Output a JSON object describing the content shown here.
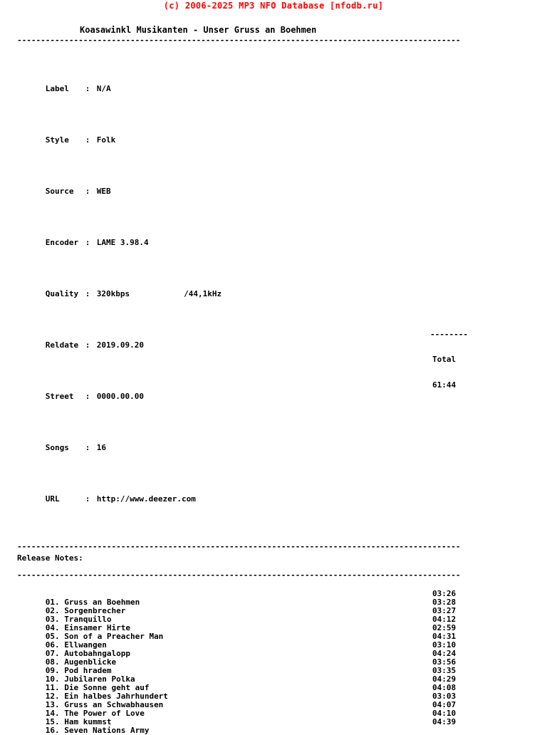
{
  "header": {
    "banner": "(c) 2006-2025 MP3 NFO Database [nfodb.ru]",
    "banner_color": "#ff0000"
  },
  "release": {
    "title": "Koasawinkl Musikanten - Unser Gruss an Boehmen"
  },
  "separators": {
    "long": "----------------------------------------------------------------------------------------------",
    "short": "--------"
  },
  "meta": {
    "rows": [
      {
        "key": "Label",
        "sep": ":",
        "value": "N/A",
        "extra": ""
      },
      {
        "key": "Style",
        "sep": ":",
        "value": "Folk",
        "extra": ""
      },
      {
        "key": "Source",
        "sep": ":",
        "value": "WEB",
        "extra": ""
      },
      {
        "key": "Encoder",
        "sep": ":",
        "value": "LAME 3.98.4",
        "extra": ""
      },
      {
        "key": "Quality",
        "sep": ":",
        "value": "320kbps",
        "extra": "/44,1kHz"
      },
      {
        "key": "Reldate",
        "sep": ":",
        "value": "2019.09.20",
        "extra": ""
      },
      {
        "key": "Street",
        "sep": ":",
        "value": "0000.00.00",
        "extra": ""
      },
      {
        "key": "Songs",
        "sep": ":",
        "value": "16",
        "extra": ""
      },
      {
        "key": "URL",
        "sep": ":",
        "value": "http://www.deezer.com",
        "extra": ""
      }
    ]
  },
  "notes": {
    "label": "Release Notes:",
    "body": ""
  },
  "tracks": [
    {
      "num": "01.",
      "title": "Gruss an Boehmen",
      "time": "03:26"
    },
    {
      "num": "02.",
      "title": "Sorgenbrecher",
      "time": "03:28"
    },
    {
      "num": "03.",
      "title": "Tranquillo",
      "time": "03:27"
    },
    {
      "num": "04.",
      "title": "Einsamer Hirte",
      "time": "04:12"
    },
    {
      "num": "05.",
      "title": "Son of a Preacher Man",
      "time": "02:59"
    },
    {
      "num": "06.",
      "title": "Ellwangen",
      "time": "04:31"
    },
    {
      "num": "07.",
      "title": "Autobahngalopp",
      "time": "03:10"
    },
    {
      "num": "08.",
      "title": "Augenblicke",
      "time": "04:24"
    },
    {
      "num": "09.",
      "title": "Pod hradem",
      "time": "03:56"
    },
    {
      "num": "10.",
      "title": "Jubilaren Polka",
      "time": "03:35"
    },
    {
      "num": "11.",
      "title": "Die Sonne geht auf",
      "time": "04:29"
    },
    {
      "num": "12.",
      "title": "Ein halbes Jahrhundert",
      "time": "04:08"
    },
    {
      "num": "13.",
      "title": "Gruss an Schwabhausen",
      "time": "03:03"
    },
    {
      "num": "14.",
      "title": "The Power of Love",
      "time": "04:07"
    },
    {
      "num": "15.",
      "title": "Ham kummst",
      "time": "04:10"
    },
    {
      "num": "16.",
      "title": "Seven Nations Army",
      "time": "04:39"
    }
  ],
  "total": {
    "label": "Total",
    "value": "61:44"
  }
}
